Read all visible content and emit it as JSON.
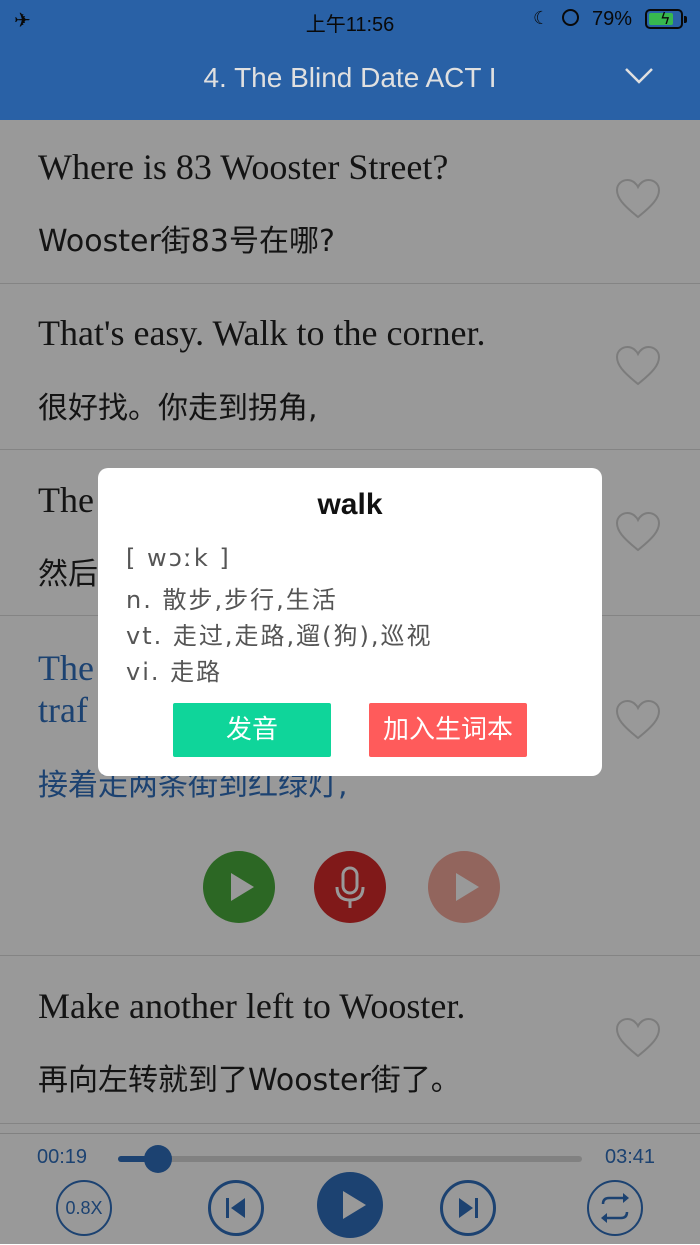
{
  "status": {
    "time": "上午11:56",
    "battery_percent": "79%",
    "battery_level": 0.79,
    "icons": [
      "airplane-icon",
      "moon-icon",
      "rotation-lock-icon",
      "battery-charging-icon"
    ]
  },
  "header": {
    "title": "4. The Blind Date ACT I",
    "dropdown_icon": "chevron-down-icon"
  },
  "sentences": [
    {
      "en": "Where is 83 Wooster Street?",
      "zh": "Wooster街83号在哪?"
    },
    {
      "en": "That's easy. Walk to the corner.",
      "zh": "很好找。你走到拐角,"
    },
    {
      "en": "The",
      "zh": "然后"
    },
    {
      "en": "The",
      "en2": "traf",
      "zh": "接着走两条街到红绿灯,"
    },
    {
      "en": "Make another left to Wooster.",
      "zh": "再向左转就到了Wooster街了。"
    }
  ],
  "sentence_controls": [
    "play-icon",
    "microphone-icon",
    "playback-icon"
  ],
  "player": {
    "elapsed": "00:19",
    "total": "03:41",
    "progress": 0.086,
    "speed": "0.8X",
    "icons": [
      "skip-previous-icon",
      "play-icon",
      "skip-next-icon",
      "repeat-icon"
    ]
  },
  "dialog": {
    "word": "walk",
    "phonetic": "[ wɔːk ]",
    "definitions": [
      "n. 散步,步行,生活",
      "vt. 走过,走路,遛(狗),巡视",
      "vi. 走路"
    ],
    "pronounce_label": "发音",
    "add_label": "加入生词本",
    "colors": {
      "pronounce": "#0fd59a",
      "add": "#ff5b5b",
      "accent": "#2f6fbd"
    }
  }
}
